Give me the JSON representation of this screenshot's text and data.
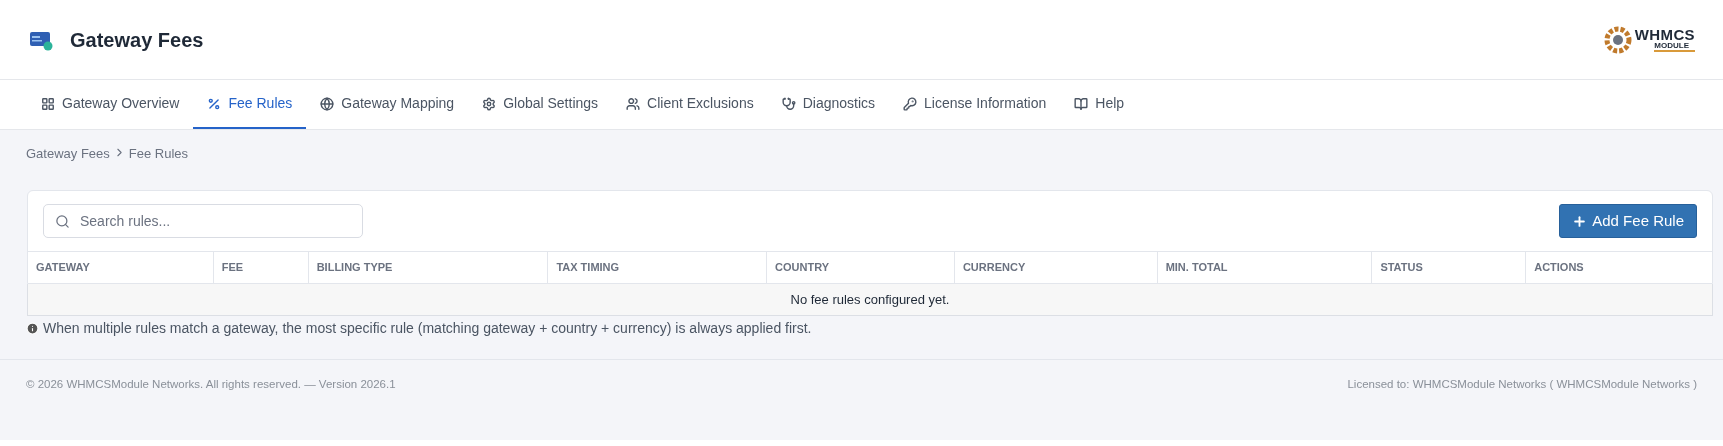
{
  "header": {
    "title": "Gateway Fees",
    "logo": {
      "line_1": "WHMCS",
      "line_2": "MODULE"
    }
  },
  "tabs": [
    {
      "label": "Gateway Overview",
      "selected": false
    },
    {
      "label": "Fee Rules",
      "selected": true
    },
    {
      "label": "Gateway Mapping",
      "selected": false
    },
    {
      "label": "Global Settings",
      "selected": false
    },
    {
      "label": "Client Exclusions",
      "selected": false
    },
    {
      "label": "Diagnostics",
      "selected": false
    },
    {
      "label": "License Information",
      "selected": false
    },
    {
      "label": "Help",
      "selected": false
    }
  ],
  "breadcrumb": [
    "Gateway Fees",
    "Fee Rules"
  ],
  "search": {
    "placeholder": "Search rules..."
  },
  "add_button": "Add Fee Rule",
  "table": {
    "columns": [
      "GATEWAY",
      "FEE",
      "BILLING TYPE",
      "TAX TIMING",
      "COUNTRY",
      "CURRENCY",
      "MIN. TOTAL",
      "STATUS",
      "ACTIONS"
    ],
    "empty_message": "No fee rules configured yet."
  },
  "note": "When multiple rules match a gateway, the most specific rule (matching gateway + country + currency) is always applied first.",
  "footer": {
    "copyright": "© 2026 WHMCSModule Networks. All rights reserved. — Version 2026.1",
    "license": "Licensed to: WHMCSModule Networks ( WHMCSModule Networks )"
  }
}
